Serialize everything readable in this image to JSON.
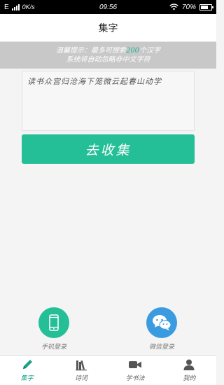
{
  "status": {
    "carrier": "E",
    "speed": "0K/s",
    "time": "09:56",
    "battery": "70%",
    "battery_level": 0.7
  },
  "header": {
    "title": "集字"
  },
  "tip": {
    "prefix": "温馨提示：最多可搜索",
    "count": "200",
    "suffix": "个汉字",
    "line2": "系统将自动忽略非中文字符"
  },
  "input": {
    "value": "读书众宫归沧海下笼微云起春山动学"
  },
  "actions": {
    "go_label": "去收集"
  },
  "login": {
    "phone_label": "手机登录",
    "wechat_label": "微信登录"
  },
  "tabs": [
    {
      "label": "集字",
      "icon": "pencil-icon",
      "active": true
    },
    {
      "label": "诗词",
      "icon": "books-icon",
      "active": false
    },
    {
      "label": "学书法",
      "icon": "video-icon",
      "active": false
    },
    {
      "label": "我的",
      "icon": "person-icon",
      "active": false
    }
  ],
  "colors": {
    "accent": "#25bf97",
    "active_tab": "#1aa389",
    "wechat": "#3a9be0"
  }
}
